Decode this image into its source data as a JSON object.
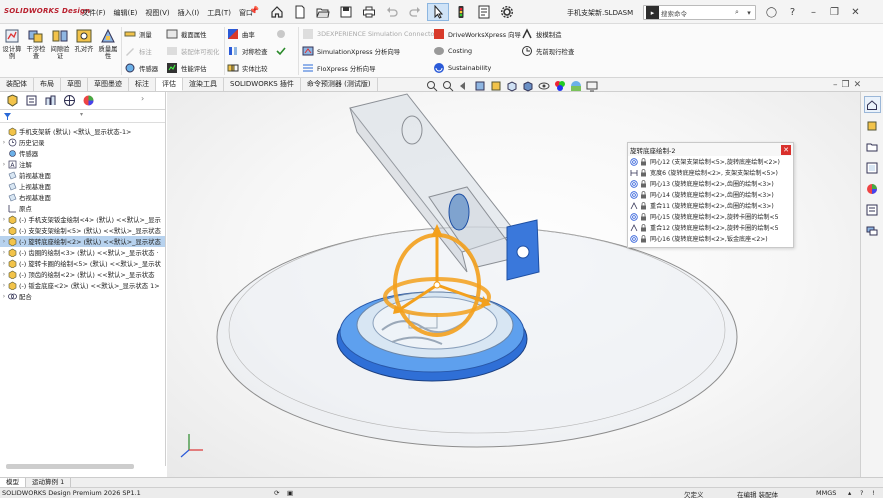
{
  "app": {
    "logo_text": "SOLIDWORKS Design",
    "document_title": "手机支架新.SLDASM",
    "accent_color": "#b9202e"
  },
  "menu": [
    "文件(F)",
    "编辑(E)",
    "视图(V)",
    "插入(I)",
    "工具(T)",
    "窗口"
  ],
  "search": {
    "placeholder": "搜索命令"
  },
  "command_manager": {
    "big_buttons": [
      {
        "icon": "design-study-icon",
        "label": "设计算例"
      },
      {
        "icon": "interference-check-icon",
        "label": "干涉检查"
      },
      {
        "icon": "clearance-verify-icon",
        "label": "间隙验证"
      },
      {
        "icon": "hole-alignment-icon",
        "label": "孔对齐"
      },
      {
        "icon": "mass-properties-icon",
        "label": "质量属性"
      }
    ],
    "small_buttons": [
      {
        "icon": "measure-icon",
        "label": "测量",
        "enabled": true
      },
      {
        "icon": "markup-icon",
        "label": "标注",
        "enabled": false
      },
      {
        "icon": "sensor-icon",
        "label": "传感器",
        "enabled": true
      },
      {
        "icon": "section-properties-icon",
        "label": "截面属性",
        "enabled": true
      },
      {
        "icon": "assembly-visualization-icon",
        "label": "装配体可视化",
        "enabled": false
      },
      {
        "icon": "performance-evaluation-icon",
        "label": "性能评估",
        "enabled": true
      },
      {
        "icon": "curvature-icon",
        "label": "曲率",
        "enabled": true
      },
      {
        "icon": "symmetry-check-icon",
        "label": "对称检查",
        "enabled": true
      },
      {
        "icon": "compare-icon",
        "label": "实体比较",
        "enabled": true
      },
      {
        "icon": "simulation-connector-icon",
        "label": "3DEXPERIENCE Simulation Connector",
        "enabled": false
      },
      {
        "icon": "simulationxpress-icon",
        "label": "SimulationXpress 分析向导",
        "enabled": true
      },
      {
        "icon": "floxpress-icon",
        "label": "FloXpress 分析向导",
        "enabled": true
      },
      {
        "icon": "driveworksxpress-icon",
        "label": "DriveWorksXpress 向导",
        "enabled": true
      },
      {
        "icon": "costing-icon",
        "label": "Costing",
        "enabled": true
      },
      {
        "icon": "sustainability-icon",
        "label": "Sustainability",
        "enabled": true
      },
      {
        "icon": "rib-icon",
        "label": "拔模制造",
        "enabled": true
      },
      {
        "icon": "advanced-analysis-icon",
        "label": "先前现行检查",
        "enabled": true
      }
    ]
  },
  "tabs": [
    "装配体",
    "布局",
    "草图",
    "草图墨迹",
    "标注",
    "评估",
    "渲染工具",
    "SOLIDWORKS 插件",
    "命令预测器 (测试版)"
  ],
  "active_tab": "评估",
  "feature_tree": {
    "filter_icon": "filter-icon",
    "items": [
      {
        "icon": "assembly-icon",
        "label": "手机支架新 (默认) <默认_显示状态-1>",
        "arrow": "",
        "selected": false
      },
      {
        "icon": "history-icon",
        "label": "历史记录",
        "arrow": "›",
        "selected": false
      },
      {
        "icon": "sensor-icon",
        "label": "传感器",
        "arrow": "",
        "selected": false
      },
      {
        "icon": "annotation-icon",
        "label": "注解",
        "arrow": "›",
        "selected": false
      },
      {
        "icon": "plane-icon",
        "label": "前视基准面",
        "arrow": "",
        "selected": false
      },
      {
        "icon": "plane-icon",
        "label": "上视基准面",
        "arrow": "",
        "selected": false
      },
      {
        "icon": "plane-icon",
        "label": "右视基准面",
        "arrow": "",
        "selected": false
      },
      {
        "icon": "origin-icon",
        "label": "原点",
        "arrow": "",
        "selected": false
      },
      {
        "icon": "part-icon",
        "label": "(-) 手机支架钣金绘制<4> (默认) <<默认>_显示",
        "arrow": "›",
        "selected": false
      },
      {
        "icon": "part-icon",
        "label": "(-) 支架支架绘制<5> (默认) <<默认>_显示状态",
        "arrow": "›",
        "selected": false
      },
      {
        "icon": "part-icon",
        "label": "(-) 旋转底座绘制<2> (默认) <<默认>_显示状态",
        "arrow": "›",
        "selected": true
      },
      {
        "icon": "part-icon",
        "label": "(-) 齿圈的绘制<3> (默认) <<默认>_显示状态 ·",
        "arrow": "›",
        "selected": false
      },
      {
        "icon": "part-icon",
        "label": "(-) 旋转卡圈的绘制<5> (默认) <<默认>_显示状",
        "arrow": "›",
        "selected": false
      },
      {
        "icon": "part-icon",
        "label": "(-) 顶齿的绘制<2> (默认) <<默认>_显示状态",
        "arrow": "›",
        "selected": false
      },
      {
        "icon": "part-icon",
        "label": "(-) 钣金底座<2> (默认) <<默认>_显示状态 1>",
        "arrow": "›",
        "selected": false
      },
      {
        "icon": "mate-icon",
        "label": "配合",
        "arrow": "›",
        "selected": false
      }
    ]
  },
  "mates_popup": {
    "title": "旋转底座绘制-2",
    "items": [
      {
        "icon": "concentric-icon",
        "label": "同心12 (支架支架绘制<5>,旋转底座绘制<2>)"
      },
      {
        "icon": "width-icon",
        "label": "宽度6 (旋转底座绘制<2>, 支架支架绘制<5>)"
      },
      {
        "icon": "concentric-icon",
        "label": "同心13 (旋转底座绘制<2>,齿圈的绘制<3>)"
      },
      {
        "icon": "concentric-icon",
        "label": "同心14 (旋转底座绘制<2>,齿圈的绘制<3>)"
      },
      {
        "icon": "coincident-icon",
        "label": "重合11 (旋转底座绘制<2>,齿圈的绘制<3>)"
      },
      {
        "icon": "concentric-icon",
        "label": "同心15 (旋转底座绘制<2>,旋转卡圈的绘制<5"
      },
      {
        "icon": "coincident-icon",
        "label": "重合12 (旋转底座绘制<2>,旋转卡圈的绘制<5"
      },
      {
        "icon": "concentric-icon",
        "label": "同心16 (旋转底座绘制<2>,钣金底座<2>)"
      }
    ]
  },
  "bottom_tabs": [
    "模型",
    "运动算例 1"
  ],
  "active_bottom_tab": "模型",
  "status": {
    "product": "SOLIDWORKS Design Premium 2026 SP1.1",
    "state": "欠定义",
    "editing": "在编辑 装配体",
    "units": "MMGS"
  }
}
